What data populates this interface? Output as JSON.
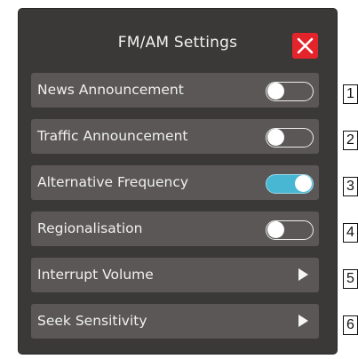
{
  "header": {
    "title": "FM/AM Settings",
    "close_icon": "close-icon",
    "close_color": "#e3242b"
  },
  "settings": [
    {
      "label": "News Announcement",
      "control": "toggle",
      "state": "off"
    },
    {
      "label": "Traffic Announcement",
      "control": "toggle",
      "state": "off"
    },
    {
      "label": "Alternative Frequency",
      "control": "toggle",
      "state": "on"
    },
    {
      "label": "Regionalisation",
      "control": "toggle",
      "state": "off"
    },
    {
      "label": "Interrupt Volume",
      "control": "arrow",
      "icon": "play-arrow-icon"
    },
    {
      "label": "Seek Sensitivity",
      "control": "arrow",
      "icon": "play-arrow-icon"
    }
  ],
  "callouts": [
    "1",
    "2",
    "3",
    "4",
    "5",
    "6"
  ],
  "colors": {
    "panel": "#3a3938",
    "row": "#5b5757",
    "toggle_on": "#48b7d3"
  }
}
